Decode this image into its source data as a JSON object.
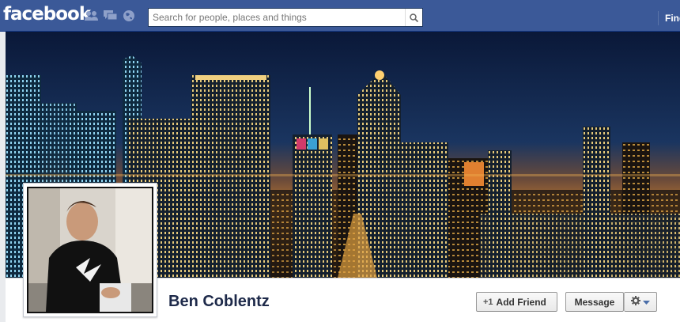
{
  "header": {
    "logo": "facebook",
    "search_placeholder": "Search for people, places and things",
    "nav_link": "Find"
  },
  "icons": {
    "friends": "friend-requests-icon",
    "messages": "messages-icon",
    "notifications": "globe-notifications-icon",
    "search": "search-icon",
    "gear": "gear-icon",
    "dropdown": "caret-down-icon",
    "add_friend": "add-friend-icon"
  },
  "profile": {
    "name": "Ben Coblentz",
    "add_friend_label": "Add Friend",
    "message_label": "Message"
  },
  "colors": {
    "brand": "#3b5998",
    "name": "#1e2a4a"
  }
}
